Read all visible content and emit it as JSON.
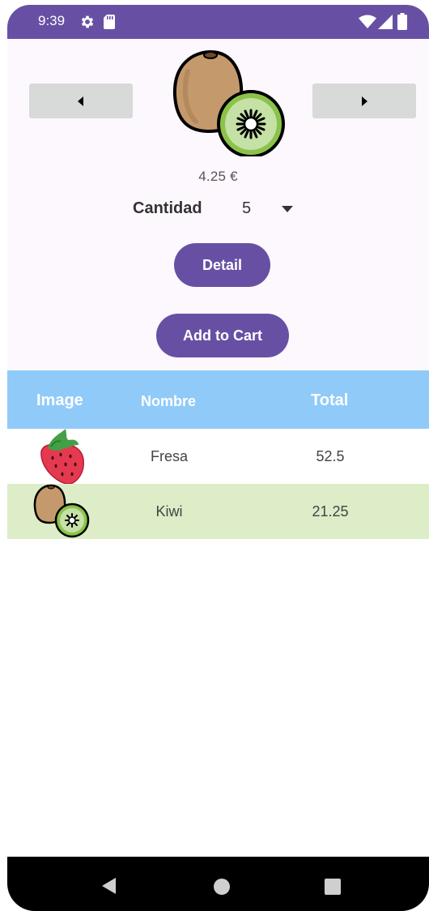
{
  "status_bar": {
    "time": "9:39",
    "icons": [
      "gear-icon",
      "sd-card-icon",
      "wifi-icon",
      "signal-icon",
      "battery-icon"
    ]
  },
  "product": {
    "image_icon": "kiwi-icon",
    "price": "4.25 €",
    "quantity_label": "Cantidad",
    "quantity_value": "5",
    "prev_icon": "arrow-left-icon",
    "next_icon": "arrow-right-icon"
  },
  "buttons": {
    "detail": "Detail",
    "add_to_cart": "Add to Cart"
  },
  "cart_table": {
    "headers": {
      "image": "Image",
      "name": "Nombre",
      "total": "Total"
    },
    "rows": [
      {
        "image_icon": "strawberry-icon",
        "name": "Fresa",
        "total": "52.5"
      },
      {
        "image_icon": "kiwi-icon",
        "name": "Kiwi",
        "total": "21.25"
      }
    ]
  },
  "colors": {
    "primary": "#6750a4",
    "table_header": "#90caf9",
    "row_highlight": "#dcedc8",
    "nav_button": "#d8d9d9"
  },
  "system_nav": {
    "icons": [
      "back-icon",
      "home-icon",
      "recents-icon"
    ]
  }
}
